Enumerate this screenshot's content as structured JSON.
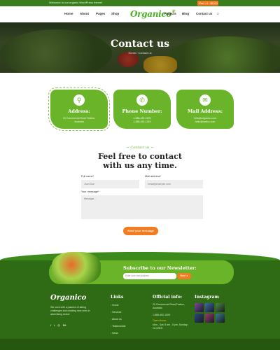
{
  "topbar": {
    "welcome": "Welcome to our organic WordPress theme!",
    "cart": "Cart : 0 - $0.00"
  },
  "nav": {
    "items": [
      "Home",
      "About",
      "Pages",
      "Shop",
      "Projects",
      "Blog",
      "Contact us"
    ],
    "logo": "Organico",
    "cart_label": "Cart - 0 - $0.00",
    "search_icon": "search-icon"
  },
  "hero": {
    "title": "Contact us",
    "breadcrumb": "Home  /  Contact us"
  },
  "cards": [
    {
      "icon": "location-icon",
      "title": "Address:",
      "lines": [
        "20 Commercial Road Fratton,",
        "Australia"
      ]
    },
    {
      "icon": "phone-icon",
      "title": "Phone Number:",
      "lines": [
        "1-888-452-1505",
        "1-888-452-1245"
      ]
    },
    {
      "icon": "mail-icon",
      "title": "Mail Address:",
      "lines": [
        "hello@organico.com",
        "hello@mailco.com"
      ]
    }
  ],
  "contact": {
    "subtitle": "~ Contact us ~",
    "heading_line1": "Feel free to contact",
    "heading_line2": "with us any time.",
    "name_label": "Full name*",
    "name_placeholder": "Jhon Doe",
    "email_label": "Mail address*",
    "email_placeholder": "email@example.com",
    "message_label": "Your message*",
    "message_placeholder": "Message...",
    "submit_label": "Send your message"
  },
  "newsletter": {
    "title": "Subscribe to our Newsletter:",
    "placeholder": "Enter your mail address",
    "button": "Send  ➜"
  },
  "footer": {
    "logo": "Organico",
    "description": "We work with a passion of taking challenges and creating new ones in advertising sector.",
    "social": [
      "f",
      "t",
      "◎",
      "Bē"
    ],
    "links_title": "Links",
    "links": [
      "Home",
      "Services",
      "About us",
      "Testimonials",
      "News"
    ],
    "info_title": "Official info:",
    "address": "20 Commercial Road Fratton, Australia",
    "phone": "1-888-452-1505",
    "open_label": "Open Hours:",
    "hours": "Mon - Sat: 8 am - 5 pm, Sunday: CLOSED",
    "instagram_title": "Instagram",
    "instagram_colors": [
      "#7a4a9a",
      "#3a6aa8",
      "#4a8a3a",
      "#2a4a7a",
      "#9a3a6a",
      "#3a7a8a"
    ]
  }
}
